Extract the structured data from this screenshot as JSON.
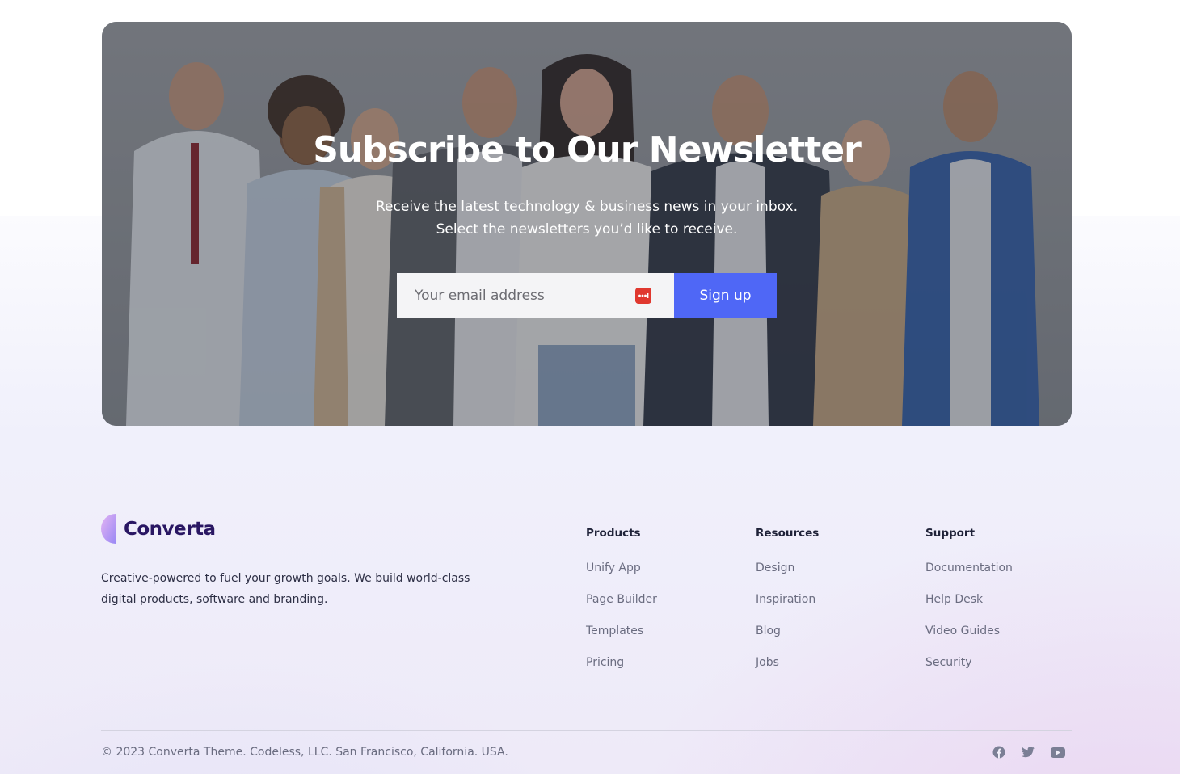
{
  "newsletter": {
    "title": "Subscribe to Our Newsletter",
    "subtitle_line1": "Receive the latest technology & business news in your inbox.",
    "subtitle_line2": "Select the newsletters you’d like to receive.",
    "email_placeholder": "Your email address",
    "signup_label": "Sign up"
  },
  "footer": {
    "brand": "Converta",
    "description": "Creative-powered to fuel your growth goals. We build world-class digital products, software and branding.",
    "columns": [
      {
        "heading": "Products",
        "links": [
          "Unify App",
          "Page Builder",
          "Templates",
          "Pricing"
        ]
      },
      {
        "heading": "Resources",
        "links": [
          "Design",
          "Inspiration",
          "Blog",
          "Jobs"
        ]
      },
      {
        "heading": "Support",
        "links": [
          "Documentation",
          "Help Desk",
          "Video Guides",
          "Security"
        ]
      }
    ],
    "copyright": "© 2023 Converta Theme. Codeless, LLC. San Francisco, California. USA.",
    "social_icons": [
      "facebook-icon",
      "twitter-icon",
      "youtube-icon"
    ]
  },
  "colors": {
    "accent": "#4f67f6",
    "brand_text": "#2a1763",
    "password_manager_icon": "#e0382f"
  }
}
